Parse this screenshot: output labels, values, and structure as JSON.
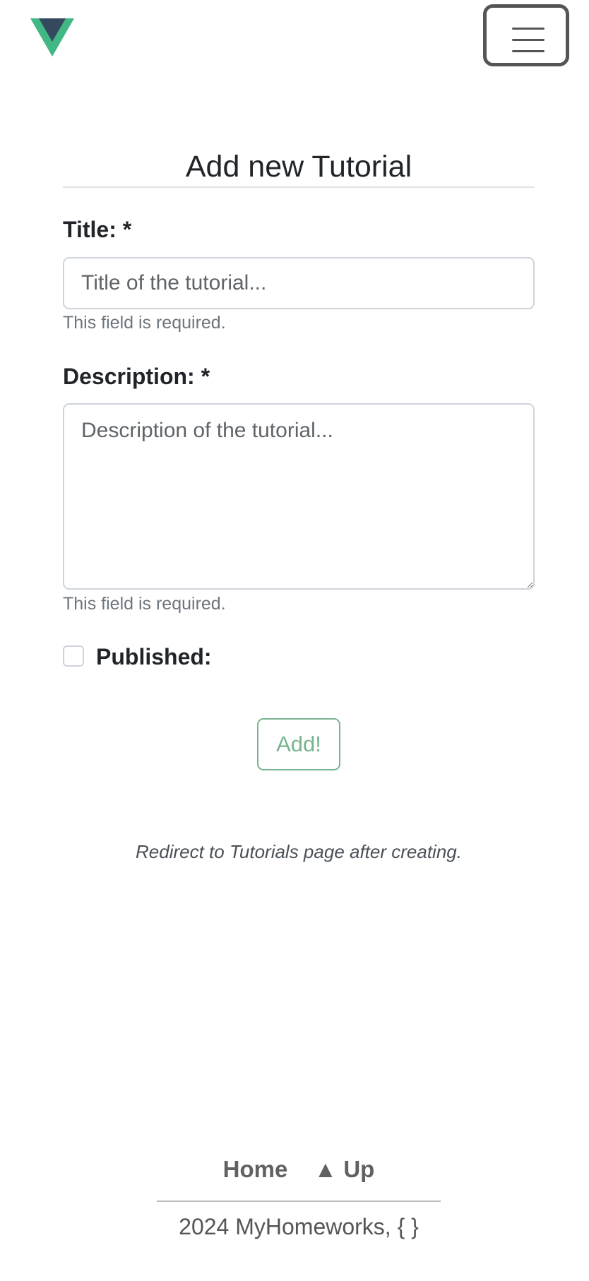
{
  "header": {
    "logo": "vue-logo",
    "menu_icon": "hamburger-menu-icon"
  },
  "form": {
    "heading": "Add new Tutorial",
    "title_label": "Title: *",
    "title_placeholder": "Title of the tutorial...",
    "title_value": "",
    "title_error": "This field is required.",
    "description_label": "Description: *",
    "description_placeholder": "Description of the tutorial...",
    "description_value": "",
    "description_error": "This field is required.",
    "published_label": "Published:",
    "published_checked": false,
    "submit_label": "Add!",
    "redirect_note": "Redirect to Tutorials page after creating."
  },
  "footer": {
    "home_label": "Home",
    "up_label": "▲ Up",
    "copyright": "2024 MyHomeworks, { }"
  },
  "colors": {
    "vue_green": "#41b883",
    "vue_dark": "#35495e",
    "button_accent": "#7ab48f",
    "hint_text": "#6c757d"
  }
}
